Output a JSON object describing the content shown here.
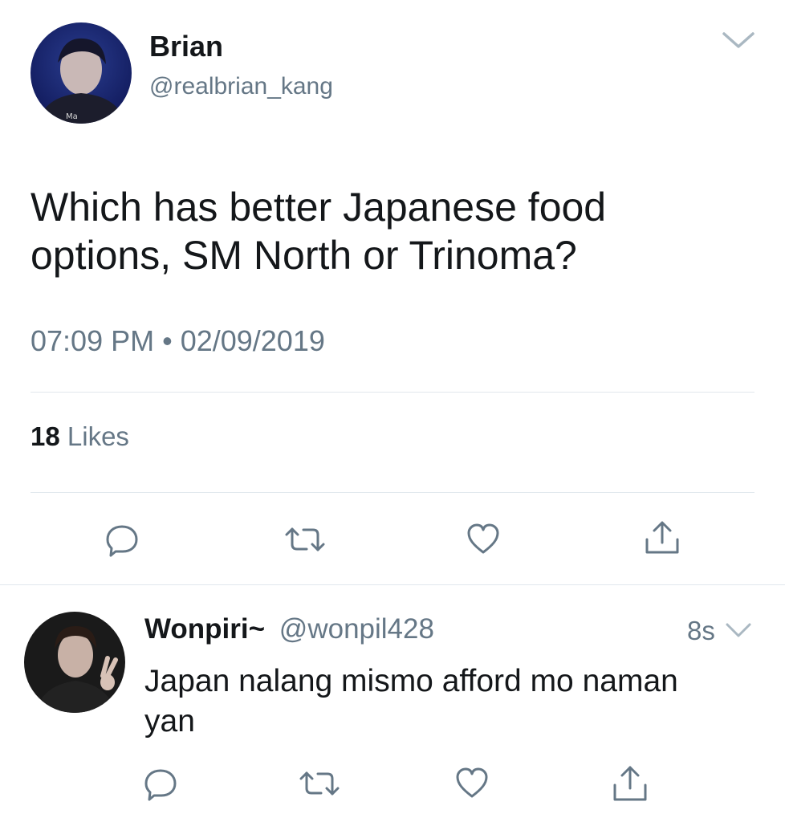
{
  "tweet": {
    "author_name": "Brian",
    "author_handle": "@realbrian_kang",
    "text_line1": "Which has better Japanese food",
    "text_line2": "options, SM North or Trinoma?",
    "timestamp": "07:09 PM • 02/09/2019",
    "likes_count": "18",
    "likes_label": "Likes",
    "avatar_icon": "user-photo-avatar"
  },
  "reply": {
    "author_name": "Wonpiri~",
    "author_handle": "@wonpil428",
    "time_ago": "8s",
    "text_line1": "Japan nalang mismo afford mo naman",
    "text_line2": "yan",
    "avatar_icon": "user-photo-avatar"
  },
  "actions": [
    "reply-icon",
    "retweet-icon",
    "like-icon",
    "share-icon"
  ],
  "colors": {
    "text_primary": "#14171a",
    "text_secondary": "#657786",
    "divider": "#e1e8ed"
  }
}
